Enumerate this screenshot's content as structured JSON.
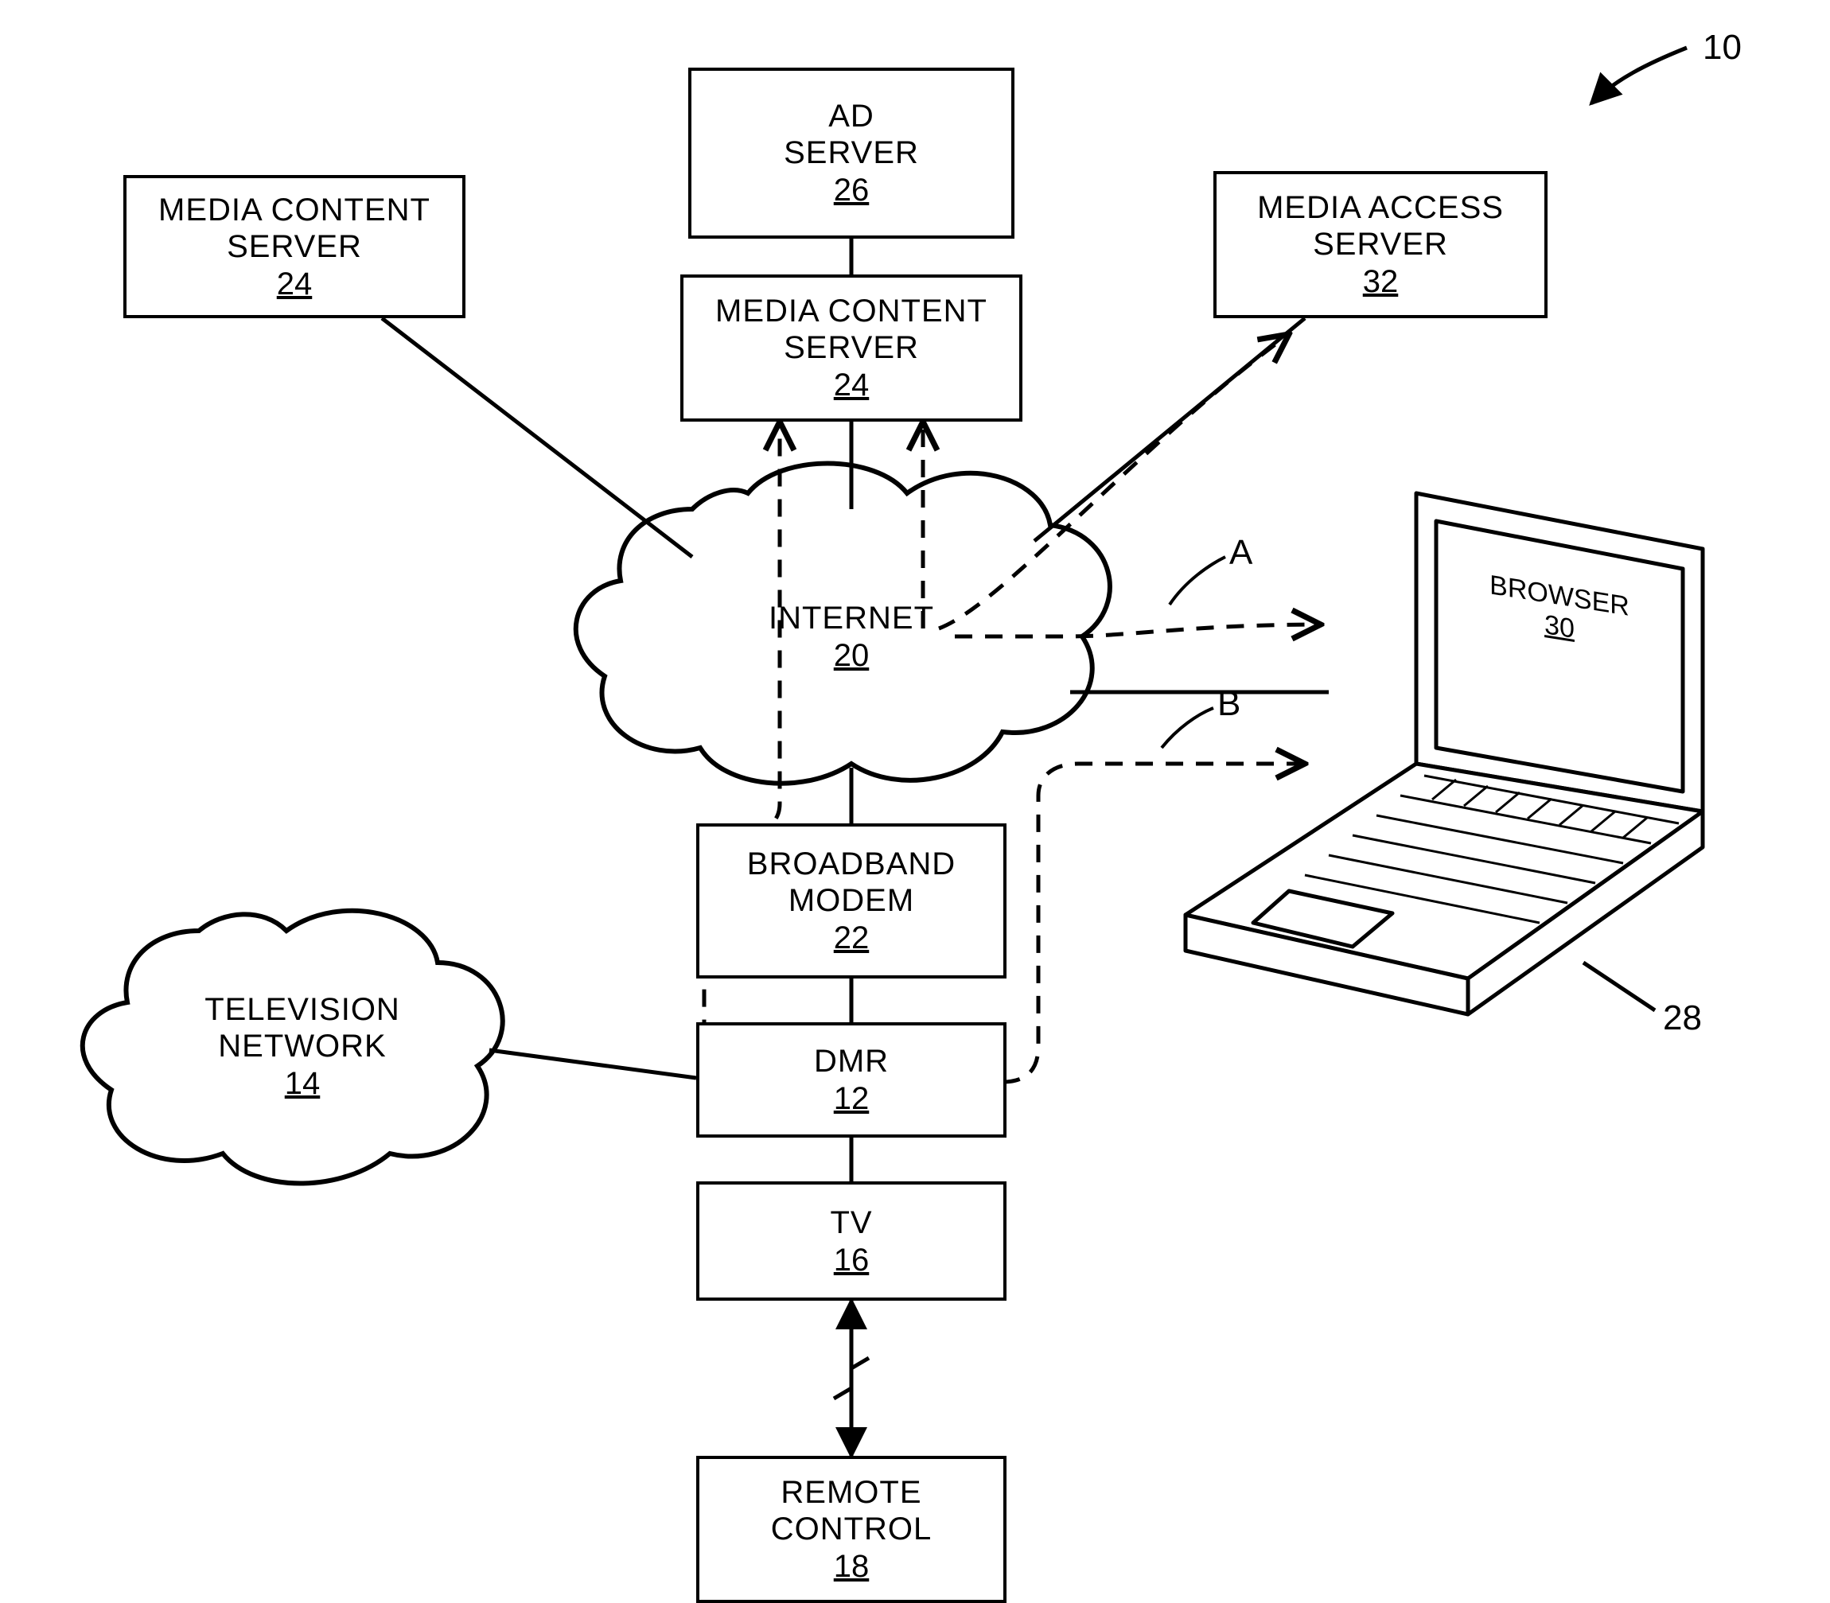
{
  "figure_ref": "10",
  "path_labels": {
    "A": "A",
    "B": "B"
  },
  "nodes": {
    "ad_server": {
      "label": "AD\nSERVER",
      "ref": "26"
    },
    "media_content_left": {
      "label": "MEDIA CONTENT\nSERVER",
      "ref": "24"
    },
    "media_content_center": {
      "label": "MEDIA CONTENT\nSERVER",
      "ref": "24"
    },
    "media_access": {
      "label": "MEDIA ACCESS\nSERVER",
      "ref": "32"
    },
    "internet": {
      "label": "INTERNET",
      "ref": "20"
    },
    "broadband_modem": {
      "label": "BROADBAND\nMODEM",
      "ref": "22"
    },
    "dmr": {
      "label": "DMR",
      "ref": "12"
    },
    "tv": {
      "label": "TV",
      "ref": "16"
    },
    "remote_control": {
      "label": "REMOTE\nCONTROL",
      "ref": "18"
    },
    "tv_network": {
      "label": "TELEVISION\nNETWORK",
      "ref": "14"
    },
    "browser": {
      "label": "BROWSER",
      "ref": "30"
    },
    "laptop": {
      "label": "",
      "ref": "28"
    }
  }
}
